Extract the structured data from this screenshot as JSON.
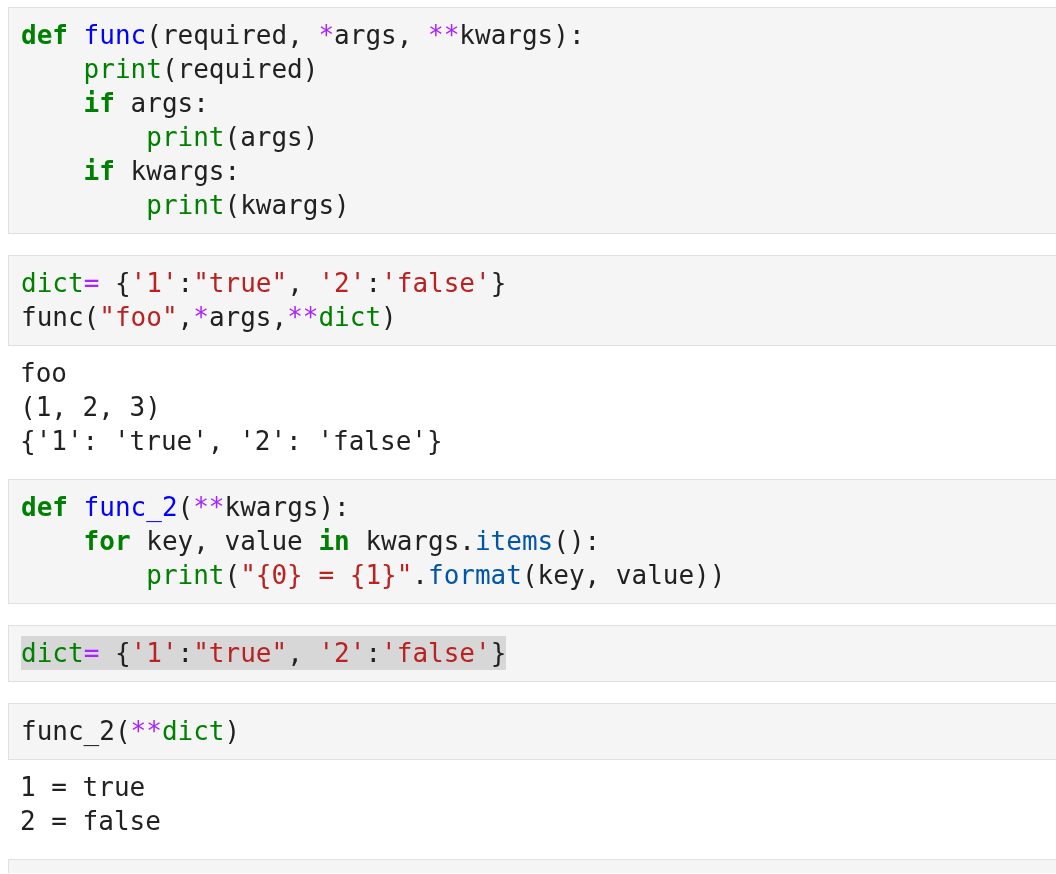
{
  "cells": [
    {
      "kind": "code",
      "lines": [
        {
          "highlighted": false,
          "tokens": [
            {
              "kind": "keyword",
              "text": "def"
            },
            {
              "kind": "defname",
              "text": " func"
            },
            {
              "kind": "plain",
              "text": "(required, "
            },
            {
              "kind": "operator",
              "text": "*"
            },
            {
              "kind": "plain",
              "text": "args, "
            },
            {
              "kind": "operator",
              "text": "**"
            },
            {
              "kind": "plain",
              "text": "kwargs):"
            }
          ]
        },
        {
          "highlighted": false,
          "tokens": [
            {
              "kind": "builtin",
              "text": "    print"
            },
            {
              "kind": "plain",
              "text": "(required)"
            }
          ]
        },
        {
          "highlighted": false,
          "tokens": [
            {
              "kind": "keyword",
              "text": "    if"
            },
            {
              "kind": "plain",
              "text": " args:"
            }
          ]
        },
        {
          "highlighted": false,
          "tokens": [
            {
              "kind": "builtin",
              "text": "        print"
            },
            {
              "kind": "plain",
              "text": "(args)"
            }
          ]
        },
        {
          "highlighted": false,
          "tokens": [
            {
              "kind": "keyword",
              "text": "    if"
            },
            {
              "kind": "plain",
              "text": " kwargs:"
            }
          ]
        },
        {
          "highlighted": false,
          "tokens": [
            {
              "kind": "builtin",
              "text": "        print"
            },
            {
              "kind": "plain",
              "text": "(kwargs)"
            }
          ]
        }
      ]
    },
    {
      "kind": "code",
      "lines": [
        {
          "highlighted": false,
          "tokens": [
            {
              "kind": "builtin",
              "text": "dict"
            },
            {
              "kind": "operator",
              "text": "="
            },
            {
              "kind": "plain",
              "text": " {"
            },
            {
              "kind": "string",
              "text": "'1'"
            },
            {
              "kind": "plain",
              "text": ":"
            },
            {
              "kind": "string",
              "text": "\"true\""
            },
            {
              "kind": "plain",
              "text": ", "
            },
            {
              "kind": "string",
              "text": "'2'"
            },
            {
              "kind": "plain",
              "text": ":"
            },
            {
              "kind": "string",
              "text": "'false'"
            },
            {
              "kind": "plain",
              "text": "}"
            }
          ]
        },
        {
          "highlighted": false,
          "tokens": [
            {
              "kind": "plain",
              "text": "func("
            },
            {
              "kind": "string",
              "text": "\"foo\""
            },
            {
              "kind": "plain",
              "text": ","
            },
            {
              "kind": "operator",
              "text": "*"
            },
            {
              "kind": "plain",
              "text": "args,"
            },
            {
              "kind": "operator",
              "text": "**"
            },
            {
              "kind": "builtin",
              "text": "dict"
            },
            {
              "kind": "plain",
              "text": ")"
            }
          ]
        }
      ],
      "output": [
        "foo",
        "(1, 2, 3)",
        "{'1': 'true', '2': 'false'}"
      ]
    },
    {
      "kind": "code",
      "lines": [
        {
          "highlighted": false,
          "tokens": [
            {
              "kind": "keyword",
              "text": "def"
            },
            {
              "kind": "defname",
              "text": " func_2"
            },
            {
              "kind": "plain",
              "text": "("
            },
            {
              "kind": "operator",
              "text": "**"
            },
            {
              "kind": "plain",
              "text": "kwargs):"
            }
          ]
        },
        {
          "highlighted": false,
          "tokens": [
            {
              "kind": "keyword",
              "text": "    for"
            },
            {
              "kind": "plain",
              "text": " key, value "
            },
            {
              "kind": "keyword",
              "text": "in"
            },
            {
              "kind": "plain",
              "text": " kwargs."
            },
            {
              "kind": "method",
              "text": "items"
            },
            {
              "kind": "plain",
              "text": "():"
            }
          ]
        },
        {
          "highlighted": false,
          "tokens": [
            {
              "kind": "builtin",
              "text": "        print"
            },
            {
              "kind": "plain",
              "text": "("
            },
            {
              "kind": "string",
              "text": "\"{0} = {1}\""
            },
            {
              "kind": "plain",
              "text": "."
            },
            {
              "kind": "method",
              "text": "format"
            },
            {
              "kind": "plain",
              "text": "(key, value))"
            }
          ]
        }
      ]
    },
    {
      "kind": "code",
      "lines": [
        {
          "highlighted": true,
          "tokens": [
            {
              "kind": "builtin",
              "text": "dict"
            },
            {
              "kind": "operator",
              "text": "="
            },
            {
              "kind": "plain",
              "text": " {"
            },
            {
              "kind": "string",
              "text": "'1'"
            },
            {
              "kind": "plain",
              "text": ":"
            },
            {
              "kind": "string",
              "text": "\"true\""
            },
            {
              "kind": "plain",
              "text": ", "
            },
            {
              "kind": "string",
              "text": "'2'"
            },
            {
              "kind": "plain",
              "text": ":"
            },
            {
              "kind": "string",
              "text": "'false'"
            },
            {
              "kind": "plain",
              "text": "}"
            }
          ]
        }
      ]
    },
    {
      "kind": "code",
      "lines": [
        {
          "highlighted": false,
          "tokens": [
            {
              "kind": "plain",
              "text": "func_2("
            },
            {
              "kind": "operator",
              "text": "**"
            },
            {
              "kind": "builtin",
              "text": "dict"
            },
            {
              "kind": "plain",
              "text": ")"
            }
          ]
        }
      ],
      "output": [
        "1 = true",
        "2 = false"
      ]
    },
    {
      "kind": "empty"
    }
  ]
}
